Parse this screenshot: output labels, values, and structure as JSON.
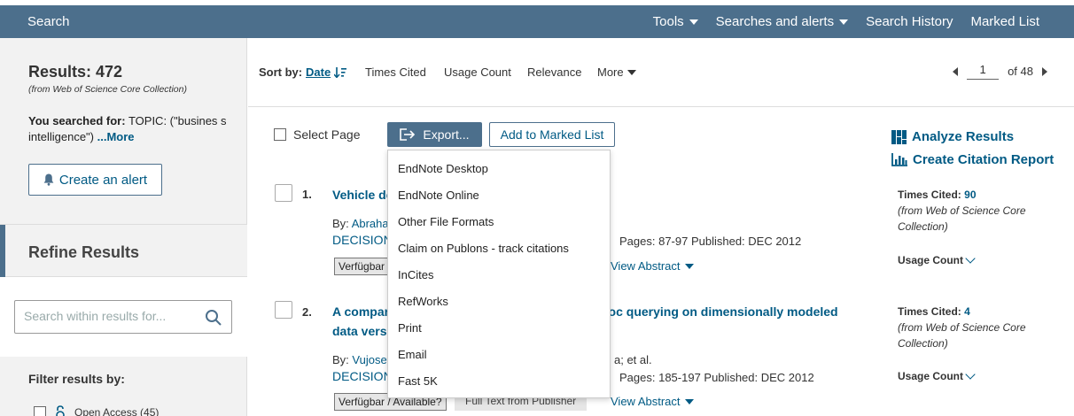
{
  "topbar": {
    "search": "Search",
    "tools": "Tools",
    "searches_alerts": "Searches and alerts",
    "history": "Search History",
    "marked": "Marked List"
  },
  "sidebar": {
    "results": "Results: 472",
    "source": "(from Web of Science Core Collection)",
    "searched_label": "You searched for:",
    "searched_query": "TOPIC: (\"busines s intelligence\")",
    "more": "...More",
    "alert": "Create an alert",
    "refine": "Refine Results",
    "search_placeholder": "Search within results for...",
    "filter_by": "Filter results by:",
    "open_access": "Open Access (45)"
  },
  "sortbar": {
    "label": "Sort by:",
    "options": [
      "Date",
      "Times Cited",
      "Usage Count",
      "Relevance",
      "More"
    ],
    "page": "1",
    "of": "of 48"
  },
  "actions": {
    "select_page": "Select Page",
    "export": "Export...",
    "add_marked": "Add to Marked List",
    "analyze": "Analyze Results",
    "citation": "Create Citation Report"
  },
  "export_menu": [
    "EndNote Desktop",
    "EndNote Online",
    "Other File Formats",
    "Claim on Publons - track citations",
    "InCites",
    "RefWorks",
    "Print",
    "Email",
    "Fast 5K"
  ],
  "records": [
    {
      "num": "1.",
      "title_start": "Vehicle de",
      "title_end": "",
      "by": "By:",
      "author": "Abraha",
      "author_tail": "",
      "journal": "DECISION",
      "pages": "Pages: 87-97   Published: DEC 2012",
      "available": "Verfügbar",
      "fulltext": "",
      "abstract": "View Abstract",
      "cited_label": "Times Cited:",
      "cited": "90",
      "cited_src": "(from Web of Science Core Collection)",
      "usage": "Usage Count"
    },
    {
      "num": "2.",
      "title_start": "A compar",
      "title_end": "hoc querying on dimensionally modeled",
      "title_line2": "data versu",
      "by": "By:",
      "author": "Vujosev",
      "author_tail": "a; et al.",
      "journal": "DECISION",
      "pages": "Pages: 185-197   Published: DEC 2012",
      "available": "Verfügbar / Available?",
      "fulltext": "Full Text from Publisher",
      "abstract": "View Abstract",
      "cited_label": "Times Cited:",
      "cited": "4",
      "cited_src": "(from Web of Science Core Collection)",
      "usage": "Usage Count"
    }
  ],
  "colors": {
    "nav_bg": "#4c6f8c",
    "link": "#005a84"
  }
}
